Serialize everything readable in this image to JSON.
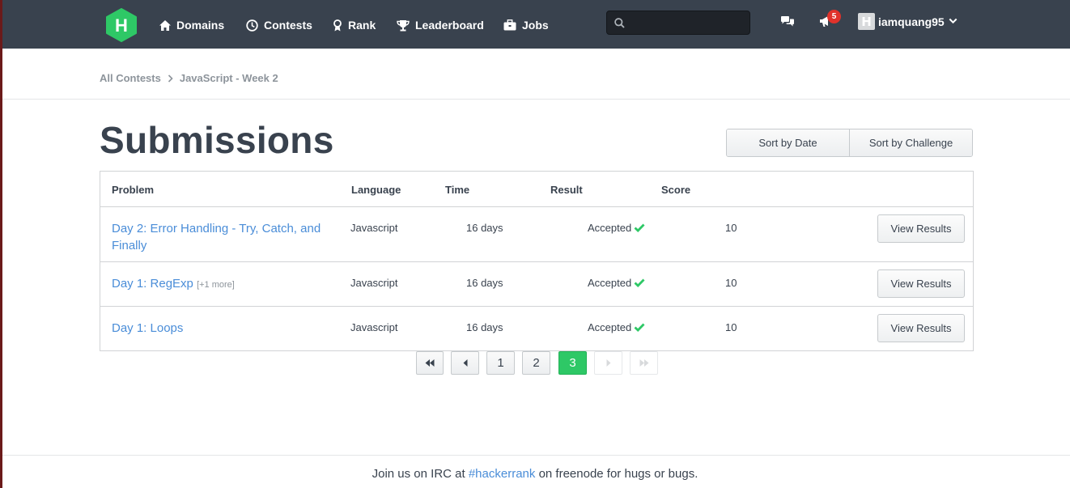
{
  "nav": {
    "items": [
      {
        "label": "Domains",
        "icon": "home-icon"
      },
      {
        "label": "Contests",
        "icon": "clock-icon"
      },
      {
        "label": "Rank",
        "icon": "ribbon-icon"
      },
      {
        "label": "Leaderboard",
        "icon": "trophy-icon"
      },
      {
        "label": "Jobs",
        "icon": "briefcase-icon"
      }
    ],
    "search_value": "",
    "notification_count": "5",
    "username": "iamquang95"
  },
  "breadcrumb": {
    "items": [
      "All Contests",
      "JavaScript - Week 2"
    ]
  },
  "page": {
    "title": "Submissions",
    "sort_by_date": "Sort by Date",
    "sort_by_challenge": "Sort by Challenge"
  },
  "table": {
    "headers": [
      "Problem",
      "Language",
      "Time",
      "Result",
      "Score"
    ],
    "rows": [
      {
        "problem": "Day 2: Error Handling - Try, Catch, and Finally",
        "more": "",
        "language": "Javascript",
        "time": "16 days",
        "result": "Accepted",
        "score": "10",
        "action": "View Results"
      },
      {
        "problem": "Day 1: RegExp",
        "more": "[+1 more]",
        "language": "Javascript",
        "time": "16 days",
        "result": "Accepted",
        "score": "10",
        "action": "View Results"
      },
      {
        "problem": "Day 1: Loops",
        "more": "",
        "language": "Javascript",
        "time": "16 days",
        "result": "Accepted",
        "score": "10",
        "action": "View Results"
      }
    ]
  },
  "pagination": {
    "pages": [
      "1",
      "2",
      "3"
    ],
    "current": "3"
  },
  "footer": {
    "prefix": "Join us on IRC at",
    "link": "#hackerrank",
    "suffix": "on freenode for hugs or bugs."
  },
  "colors": {
    "topbar": "#39424e",
    "brand_green": "#2ec866",
    "link_blue": "#4a8dd8",
    "badge_red": "#e0322b"
  }
}
